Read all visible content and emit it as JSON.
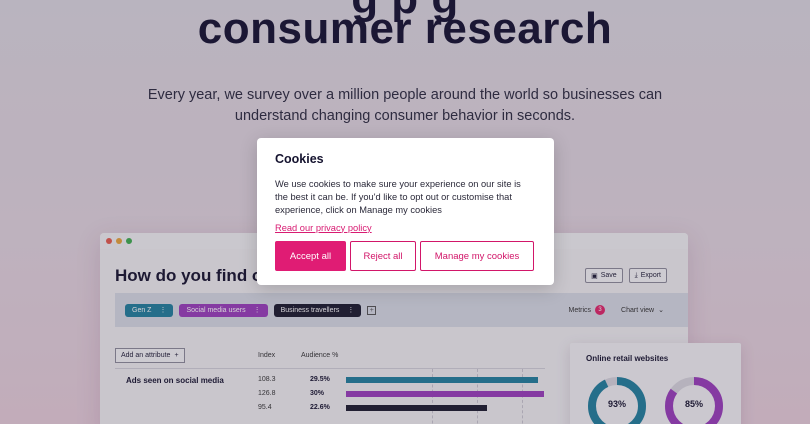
{
  "hero": {
    "title_top": "g        p                    g",
    "title": "consumer research",
    "subtitle": "Every year, we survey over a million people around the world so businesses can understand changing consumer behavior in seconds."
  },
  "dashboard": {
    "heading": "How do you find ou",
    "actions": {
      "save": "Save",
      "export": "Export"
    },
    "filters": [
      {
        "label": "Gen Z",
        "color": "#1f7f9e"
      },
      {
        "label": "Social media users",
        "color": "#9a3dbd"
      },
      {
        "label": "Business travellers",
        "color": "#1a1a2e"
      }
    ],
    "metrics_label": "Metrics",
    "metrics_count": "3",
    "chart_view_label": "Chart view",
    "add_attribute": "Add an attribute",
    "columns": {
      "index": "Index",
      "audience": "Audience %"
    },
    "row_label": "Ads seen on social media",
    "rows": [
      {
        "index": "108.3",
        "audience": "29.5%",
        "bar_fraction": 0.64,
        "color": "#1f7f9e"
      },
      {
        "index": "126.8",
        "audience": "30%",
        "bar_fraction": 0.66,
        "color": "#9a3dbd"
      },
      {
        "index": "95.4",
        "audience": "22.6%",
        "bar_fraction": 0.47,
        "color": "#1a1a2e"
      }
    ]
  },
  "retail": {
    "title": "Online retail websites",
    "donuts": [
      {
        "label": "93%",
        "value": 0.93,
        "color": "#1f7f9e"
      },
      {
        "label": "85%",
        "value": 0.85,
        "color": "#9a3dbd"
      }
    ]
  },
  "cookie": {
    "title": "Cookies",
    "text": "We use cookies to make sure your experience on our site is the best it can be. If you'd like to opt out or customise that experience, click on Manage my cookies",
    "link": "Read our privacy policy",
    "accept": "Accept all",
    "reject": "Reject all",
    "manage": "Manage my cookies"
  },
  "colors": {
    "accent": "#e01c74"
  }
}
